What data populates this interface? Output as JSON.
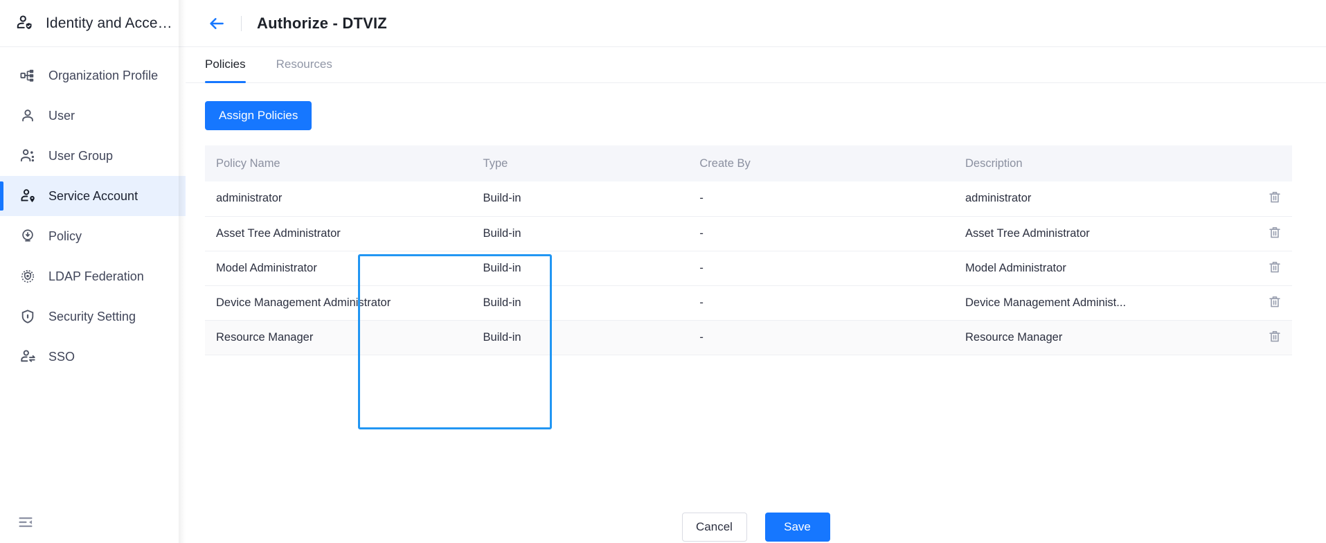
{
  "sidebar": {
    "header": {
      "title": "Identity and Acce…",
      "icon": "user-shield-icon"
    },
    "items": [
      {
        "label": "Organization Profile",
        "icon": "org-chart-icon",
        "active": false
      },
      {
        "label": "User",
        "icon": "user-icon",
        "active": false
      },
      {
        "label": "User Group",
        "icon": "user-group-icon",
        "active": false
      },
      {
        "label": "Service Account",
        "icon": "service-account-icon",
        "active": true
      },
      {
        "label": "Policy",
        "icon": "policy-icon",
        "active": false
      },
      {
        "label": "LDAP Federation",
        "icon": "ldap-federation-icon",
        "active": false
      },
      {
        "label": "Security Setting",
        "icon": "shield-lock-icon",
        "active": false
      },
      {
        "label": "SSO",
        "icon": "sso-icon",
        "active": false
      }
    ],
    "collapse_icon": "menu-collapse-icon"
  },
  "header": {
    "back_icon": "arrow-left-icon",
    "title": "Authorize - DTVIZ"
  },
  "tabs": [
    {
      "label": "Policies",
      "active": true
    },
    {
      "label": "Resources",
      "active": false
    }
  ],
  "toolbar": {
    "assign_policies_label": "Assign Policies"
  },
  "table": {
    "columns": [
      "Policy Name",
      "Type",
      "Create By",
      "Description",
      ""
    ],
    "rows": [
      {
        "name": "administrator",
        "type": "Build-in",
        "create_by": "-",
        "description": "administrator",
        "delete_icon": "trash-icon"
      },
      {
        "name": "Asset Tree Administrator",
        "type": "Build-in",
        "create_by": "-",
        "description": "Asset Tree Administrator",
        "delete_icon": "trash-icon"
      },
      {
        "name": "Model Administrator",
        "type": "Build-in",
        "create_by": "-",
        "description": "Model Administrator",
        "delete_icon": "trash-icon"
      },
      {
        "name": "Device Management Administrator",
        "type": "Build-in",
        "create_by": "-",
        "description": "Device Management Administ...",
        "delete_icon": "trash-icon"
      },
      {
        "name": "Resource Manager",
        "type": "Build-in",
        "create_by": "-",
        "description": "Resource Manager",
        "delete_icon": "trash-icon"
      }
    ]
  },
  "footer": {
    "cancel_label": "Cancel",
    "save_label": "Save"
  },
  "colors": {
    "accent": "#1677ff",
    "highlight_border": "#2196f3",
    "sidebar_active_bg": "#e9f1fe",
    "table_header_bg": "#f5f6fa"
  }
}
